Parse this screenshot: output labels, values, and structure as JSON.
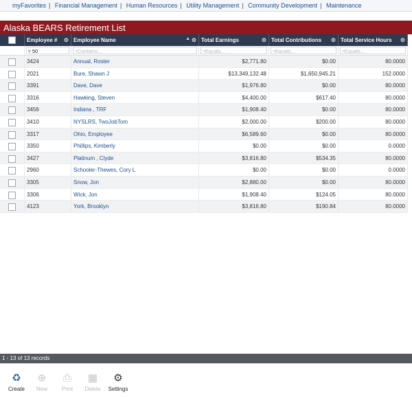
{
  "nav": {
    "items": [
      "myFavorites",
      "Financial Management",
      "Human Resources",
      "Utility Management",
      "Community Development",
      "Maintenance"
    ],
    "separator": "|"
  },
  "page": {
    "title": "Alaska BEARS Retirement List"
  },
  "grid": {
    "columns": [
      "Employee #",
      "Employee Name",
      "Total Earnings",
      "Total Contributions",
      "Total Service Hours"
    ],
    "filters": {
      "employee_no": "50",
      "employee_name_placeholder": "Contains...",
      "earnings_placeholder": "Equals...",
      "contrib_placeholder": "Equals...",
      "hours_placeholder": "Equals..."
    },
    "rows": [
      {
        "id": "3424",
        "name": "Annual, Roster",
        "earnings": "$2,771.80",
        "contrib": "$0.00",
        "hours": "80.0000"
      },
      {
        "id": "2021",
        "name": "Bure, Shawn J",
        "earnings": "$13,349,132.48",
        "contrib": "$1,650,945.21",
        "hours": "152.0000"
      },
      {
        "id": "3391",
        "name": "Dave, Dave",
        "earnings": "$1,976.80",
        "contrib": "$0.00",
        "hours": "80.0000"
      },
      {
        "id": "3316",
        "name": "Hawking, Steven",
        "earnings": "$4,400.00",
        "contrib": "$617.40",
        "hours": "80.0000"
      },
      {
        "id": "3456",
        "name": "Indiana , TRF",
        "earnings": "$1,908.40",
        "contrib": "$0.00",
        "hours": "80.0000"
      },
      {
        "id": "3410",
        "name": "NYSLRS, TwoJobTom",
        "earnings": "$2,000.00",
        "contrib": "$200.00",
        "hours": "80.0000"
      },
      {
        "id": "3317",
        "name": "Ohio, Employee",
        "earnings": "$6,589.60",
        "contrib": "$0.00",
        "hours": "80.0000"
      },
      {
        "id": "3350",
        "name": "Phillips, Kimberly",
        "earnings": "$0.00",
        "contrib": "$0.00",
        "hours": "0.0000"
      },
      {
        "id": "3427",
        "name": "Platinum , Clyde",
        "earnings": "$3,816.80",
        "contrib": "$534.35",
        "hours": "80.0000"
      },
      {
        "id": "2960",
        "name": "Schooler-Thewes, Cory L",
        "earnings": "$0.00",
        "contrib": "$0.00",
        "hours": "0.0000"
      },
      {
        "id": "3305",
        "name": "Snow, Jon",
        "earnings": "$2,880.00",
        "contrib": "$0.00",
        "hours": "80.0000"
      },
      {
        "id": "3306",
        "name": "Wick, Jon",
        "earnings": "$1,908.40",
        "contrib": "$124.05",
        "hours": "80.0000"
      },
      {
        "id": "4123",
        "name": "York, Brooklyn",
        "earnings": "$3,816.80",
        "contrib": "$190.84",
        "hours": "80.0000"
      }
    ]
  },
  "status": {
    "records": "1 - 13 of 13 records"
  },
  "toolbar": {
    "create": "Create",
    "new": "New",
    "print": "Print",
    "delete": "Delete",
    "settings": "Settings"
  },
  "colors": {
    "title_bar": "#8e1a20",
    "header": "#2d3a4f",
    "link": "#1d4e8f",
    "status_bar": "#55595f"
  },
  "icons": {
    "filter": "filter-icon",
    "gear": "gear-icon",
    "sort_asc": "sort-ascending-icon"
  }
}
